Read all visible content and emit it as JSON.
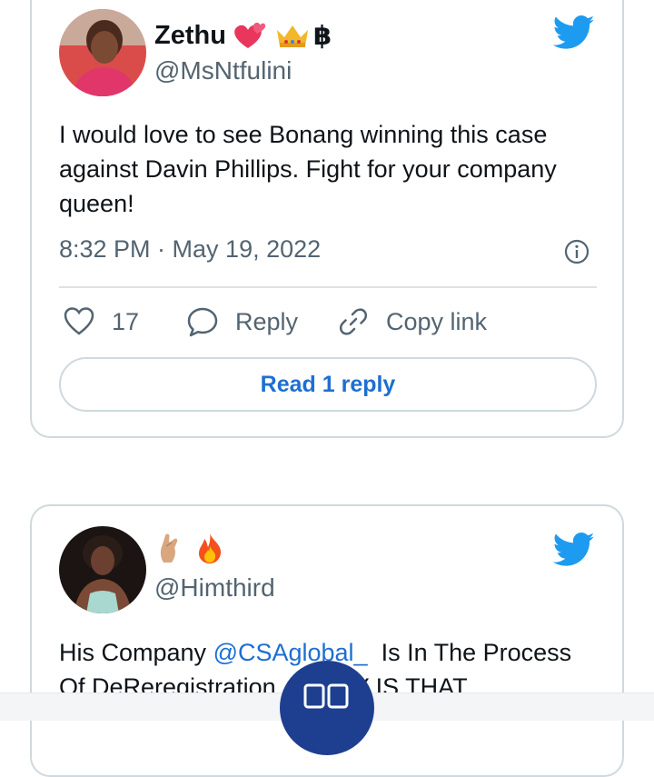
{
  "tweets": [
    {
      "display_name": "Zethu",
      "display_suffix": "฿",
      "emojis": [
        "two-hearts",
        "crown"
      ],
      "handle": "@MsNtfulini",
      "text_lines": [
        "I would love to see Bonang winning this case",
        "against Davin Phillips. Fight for your company",
        "queen!"
      ],
      "timestamp": "8:32 PM · May 19, 2022",
      "likes": "17",
      "reply_label": "Reply",
      "copy_link_label": "Copy link",
      "read_replies_label": "Read 1 reply"
    },
    {
      "display_name": "",
      "emojis": [
        "pinched-fingers",
        "fire"
      ],
      "handle": "@Himthird",
      "text_prefix": "His Company ",
      "mention": "@CSAglobal_",
      "text_suffix": "  Is In The Process",
      "text_line2_a": "Of DeReregistration ",
      "text_line2_b": "HY IS THAT"
    }
  ],
  "colors": {
    "twitter_blue": "#1d9bf0",
    "link_blue": "#1d6fd1",
    "fab_blue": "#1e3f8f"
  },
  "icons": [
    "twitter-bird-icon",
    "info-icon",
    "heart-icon",
    "reply-icon",
    "link-icon",
    "tabs-icon"
  ]
}
